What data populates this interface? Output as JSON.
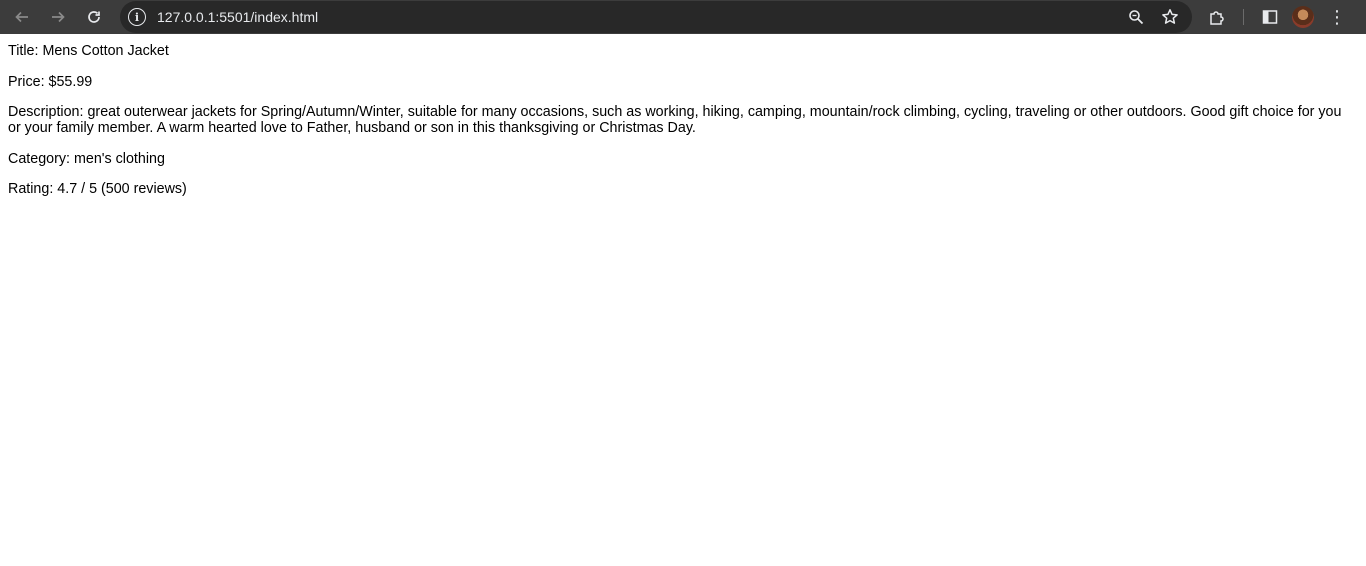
{
  "browser": {
    "url": "127.0.0.1:5501/index.html",
    "icons": {
      "back": "arrow-left-icon",
      "forward": "arrow-right-icon",
      "reload": "reload-icon",
      "site_info": "info-icon",
      "zoom": "zoom-icon",
      "bookmark": "star-icon",
      "extensions": "puzzle-icon",
      "side_panel": "side-panel-icon",
      "profile": "avatar",
      "menu": "kebab-menu-icon"
    }
  },
  "product": {
    "title_label": "Title:",
    "title": "Mens Cotton Jacket",
    "price_label": "Price:",
    "price": "$55.99",
    "description_label": "Description:",
    "description": "great outerwear jackets for Spring/Autumn/Winter, suitable for many occasions, such as working, hiking, camping, mountain/rock climbing, cycling, traveling or other outdoors. Good gift choice for you or your family member. A warm hearted love to Father, husband or son in this thanksgiving or Christmas Day.",
    "category_label": "Category:",
    "category": "men's clothing",
    "rating_label": "Rating:",
    "rating": "4.7 / 5 (500 reviews)"
  }
}
